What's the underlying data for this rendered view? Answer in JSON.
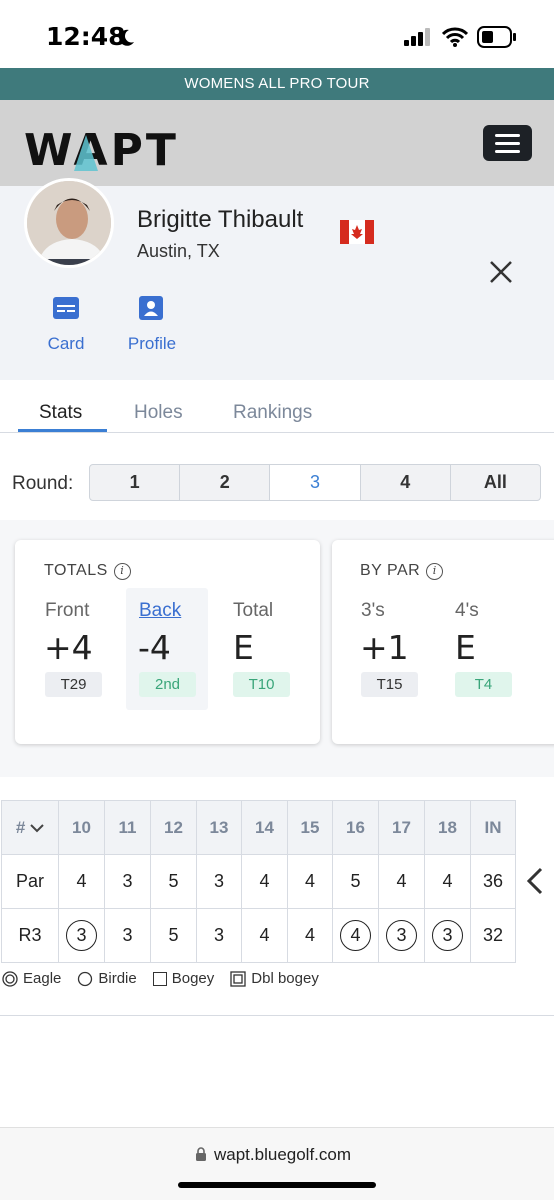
{
  "status_bar": {
    "time": "12:48",
    "icons": [
      "moon-icon",
      "signal-icon",
      "wifi-icon",
      "battery-icon"
    ]
  },
  "banner": {
    "text": "WOMENS ALL PRO TOUR",
    "color": "#3f7a7c"
  },
  "header": {
    "logo": "WAPT",
    "menu_icon": "hamburger-icon"
  },
  "player": {
    "name": "Brigitte Thibault",
    "location": "Austin, TX",
    "flag": "canada-flag",
    "links": [
      {
        "label": "Card",
        "icon": "card-icon"
      },
      {
        "label": "Profile",
        "icon": "profile-icon"
      }
    ]
  },
  "tabs": [
    {
      "label": "Stats",
      "active": true
    },
    {
      "label": "Holes",
      "active": false
    },
    {
      "label": "Rankings",
      "active": false
    }
  ],
  "round_selector": {
    "label": "Round:",
    "options": [
      "1",
      "2",
      "3",
      "4",
      "All"
    ],
    "selected": "3"
  },
  "totals": {
    "title": "TOTALS",
    "items": [
      {
        "label": "Front",
        "value": "+4",
        "rank": "T29"
      },
      {
        "label": "Back",
        "value": "-4",
        "rank": "2nd"
      },
      {
        "label": "Total",
        "value": "E",
        "rank": "T10"
      }
    ]
  },
  "by_par": {
    "title": "BY PAR",
    "items": [
      {
        "label": "3's",
        "value": "+1",
        "rank": "T15"
      },
      {
        "label": "4's",
        "value": "E",
        "rank": "T4"
      }
    ]
  },
  "scorecard": {
    "header_label": "#",
    "holes": [
      "10",
      "11",
      "12",
      "13",
      "14",
      "15",
      "16",
      "17",
      "18",
      "IN"
    ],
    "par_label": "Par",
    "par": [
      "4",
      "3",
      "5",
      "3",
      "4",
      "4",
      "5",
      "4",
      "4",
      "36"
    ],
    "round_label": "R3",
    "scores": [
      "3",
      "3",
      "5",
      "3",
      "4",
      "4",
      "4",
      "3",
      "3",
      "32"
    ]
  },
  "legend": [
    "Eagle",
    "Birdie",
    "Bogey",
    "Dbl bogey"
  ],
  "browser": {
    "url": "wapt.bluegolf.com"
  }
}
